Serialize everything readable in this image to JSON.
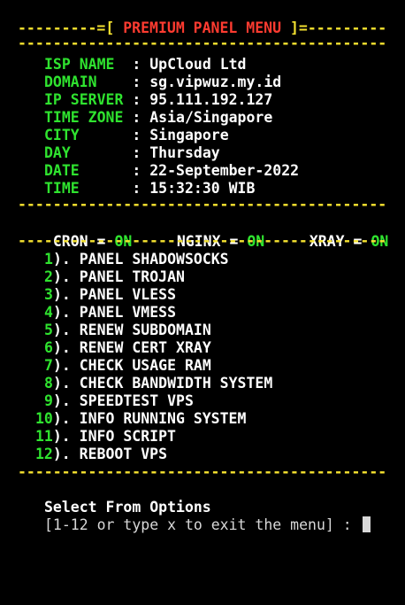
{
  "header": {
    "left_rule": "---------=[",
    "title": " PREMIUM PANEL MENU ",
    "right_rule": "]=---------"
  },
  "rule": "----------------------------------------------------------------",
  "info": [
    {
      "label": "ISP NAME ",
      "value": "UpCloud Ltd"
    },
    {
      "label": "DOMAIN   ",
      "value": "sg.vipwuz.my.id"
    },
    {
      "label": "IP SERVER",
      "value": "95.111.192.127"
    },
    {
      "label": "TIME ZONE",
      "value": "Asia/Singapore"
    },
    {
      "label": "CITY     ",
      "value": "Singapore"
    },
    {
      "label": "DAY      ",
      "value": "Thursday"
    },
    {
      "label": "DATE     ",
      "value": "22-September-2022"
    },
    {
      "label": "TIME     ",
      "value": "15:32:30 WIB"
    }
  ],
  "separator": " : ",
  "services": [
    {
      "name": "CRON",
      "status": "ON"
    },
    {
      "name": "NGINX",
      "status": "ON"
    },
    {
      "name": "XRAY",
      "status": "ON"
    }
  ],
  "menu": [
    {
      "num": "1",
      "label": "). PANEL SHADOWSOCKS"
    },
    {
      "num": "2",
      "label": "). PANEL TROJAN"
    },
    {
      "num": "3",
      "label": "). PANEL VLESS"
    },
    {
      "num": "4",
      "label": "). PANEL VMESS"
    },
    {
      "num": "5",
      "label": "). RENEW SUBDOMAIN"
    },
    {
      "num": "6",
      "label": "). RENEW CERT XRAY"
    },
    {
      "num": "7",
      "label": "). CHECK USAGE RAM"
    },
    {
      "num": "8",
      "label": "). CHECK BANDWIDTH SYSTEM"
    },
    {
      "num": "9",
      "label": "). SPEEDTEST VPS"
    },
    {
      "num": "10",
      "label": "). INFO RUNNING SYSTEM"
    },
    {
      "num": "11",
      "label": "). INFO SCRIPT"
    },
    {
      "num": "12",
      "label": "). REBOOT VPS"
    }
  ],
  "prompt": {
    "heading": "Select From Options",
    "text": "[1-12 or type x to exit the menu] :"
  },
  "colors": {
    "background": "#000000",
    "rule": "#f4e12f",
    "title": "#ff3b30",
    "label": "#2fe32f",
    "text": "#ffffff"
  }
}
